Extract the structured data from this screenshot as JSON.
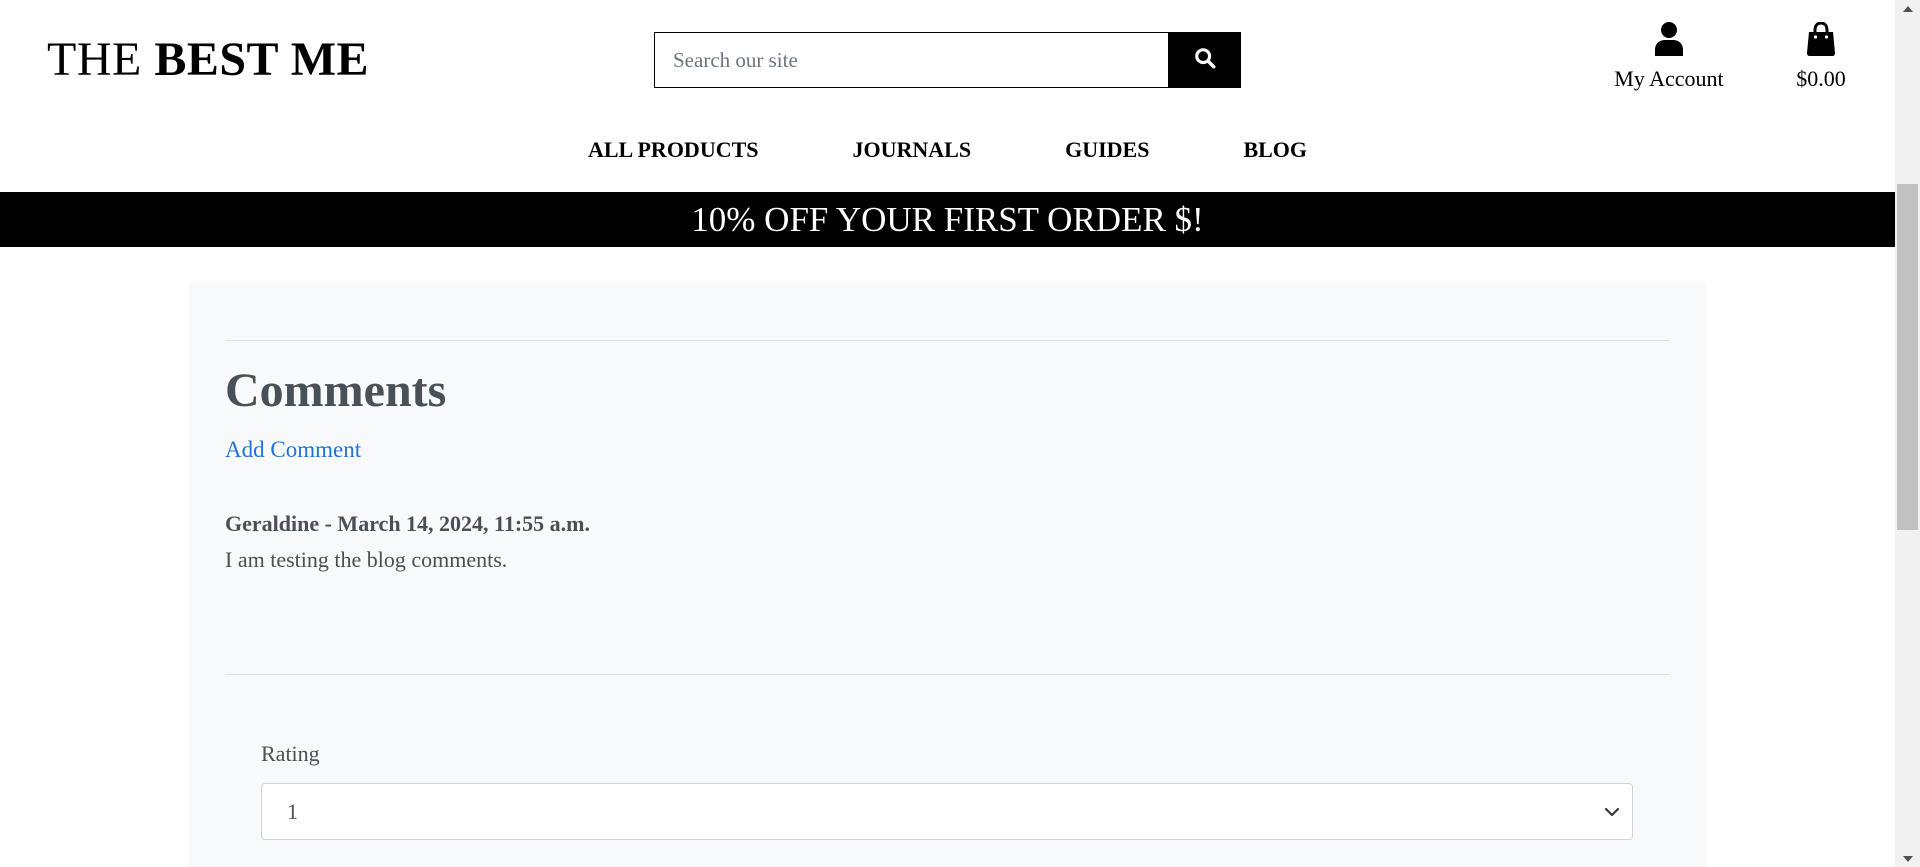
{
  "header": {
    "logo_light": "THE ",
    "logo_bold": "BEST ME",
    "search": {
      "placeholder": "Search our site",
      "value": "",
      "icon": "search-icon"
    },
    "account_label": "My Account",
    "cart_total": "$0.00"
  },
  "nav": {
    "items": [
      {
        "label": "ALL PRODUCTS"
      },
      {
        "label": "JOURNALS"
      },
      {
        "label": "GUIDES"
      },
      {
        "label": "BLOG"
      }
    ]
  },
  "banner": {
    "text": "10% OFF YOUR FIRST ORDER $!"
  },
  "comments": {
    "heading": "Comments",
    "add_comment_label": "Add Comment",
    "items": [
      {
        "meta": "Geraldine - March 14, 2024, 11:55 a.m.",
        "body": "I am testing the blog comments."
      }
    ]
  },
  "form": {
    "rating_label": "Rating",
    "rating_value": "1"
  },
  "colors": {
    "link": "#1f73d8",
    "text_muted": "#495057",
    "card_bg": "#f8f9fa",
    "banner_bg": "#000000"
  }
}
